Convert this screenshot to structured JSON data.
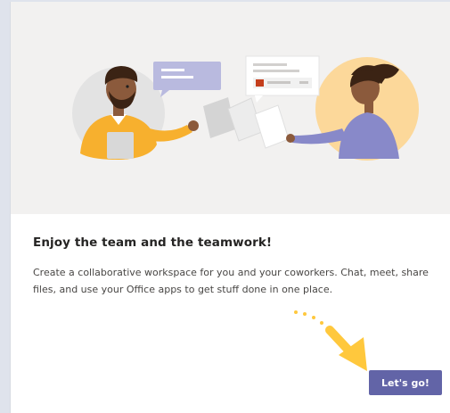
{
  "dialog": {
    "title": "Enjoy the team and the teamwork!",
    "description": "Create a collaborative workspace for you and your coworkers. Chat, meet, share files, and use your Office apps to get stuff done in one place.",
    "cta_label": "Let's go!"
  },
  "colors": {
    "accent": "#6264a7",
    "hero_background": "#f2f1f0",
    "pointer_arrow": "#ffc83d"
  },
  "icons": [
    "illustration-people-sharing-files",
    "pointer-arrow-icon"
  ]
}
